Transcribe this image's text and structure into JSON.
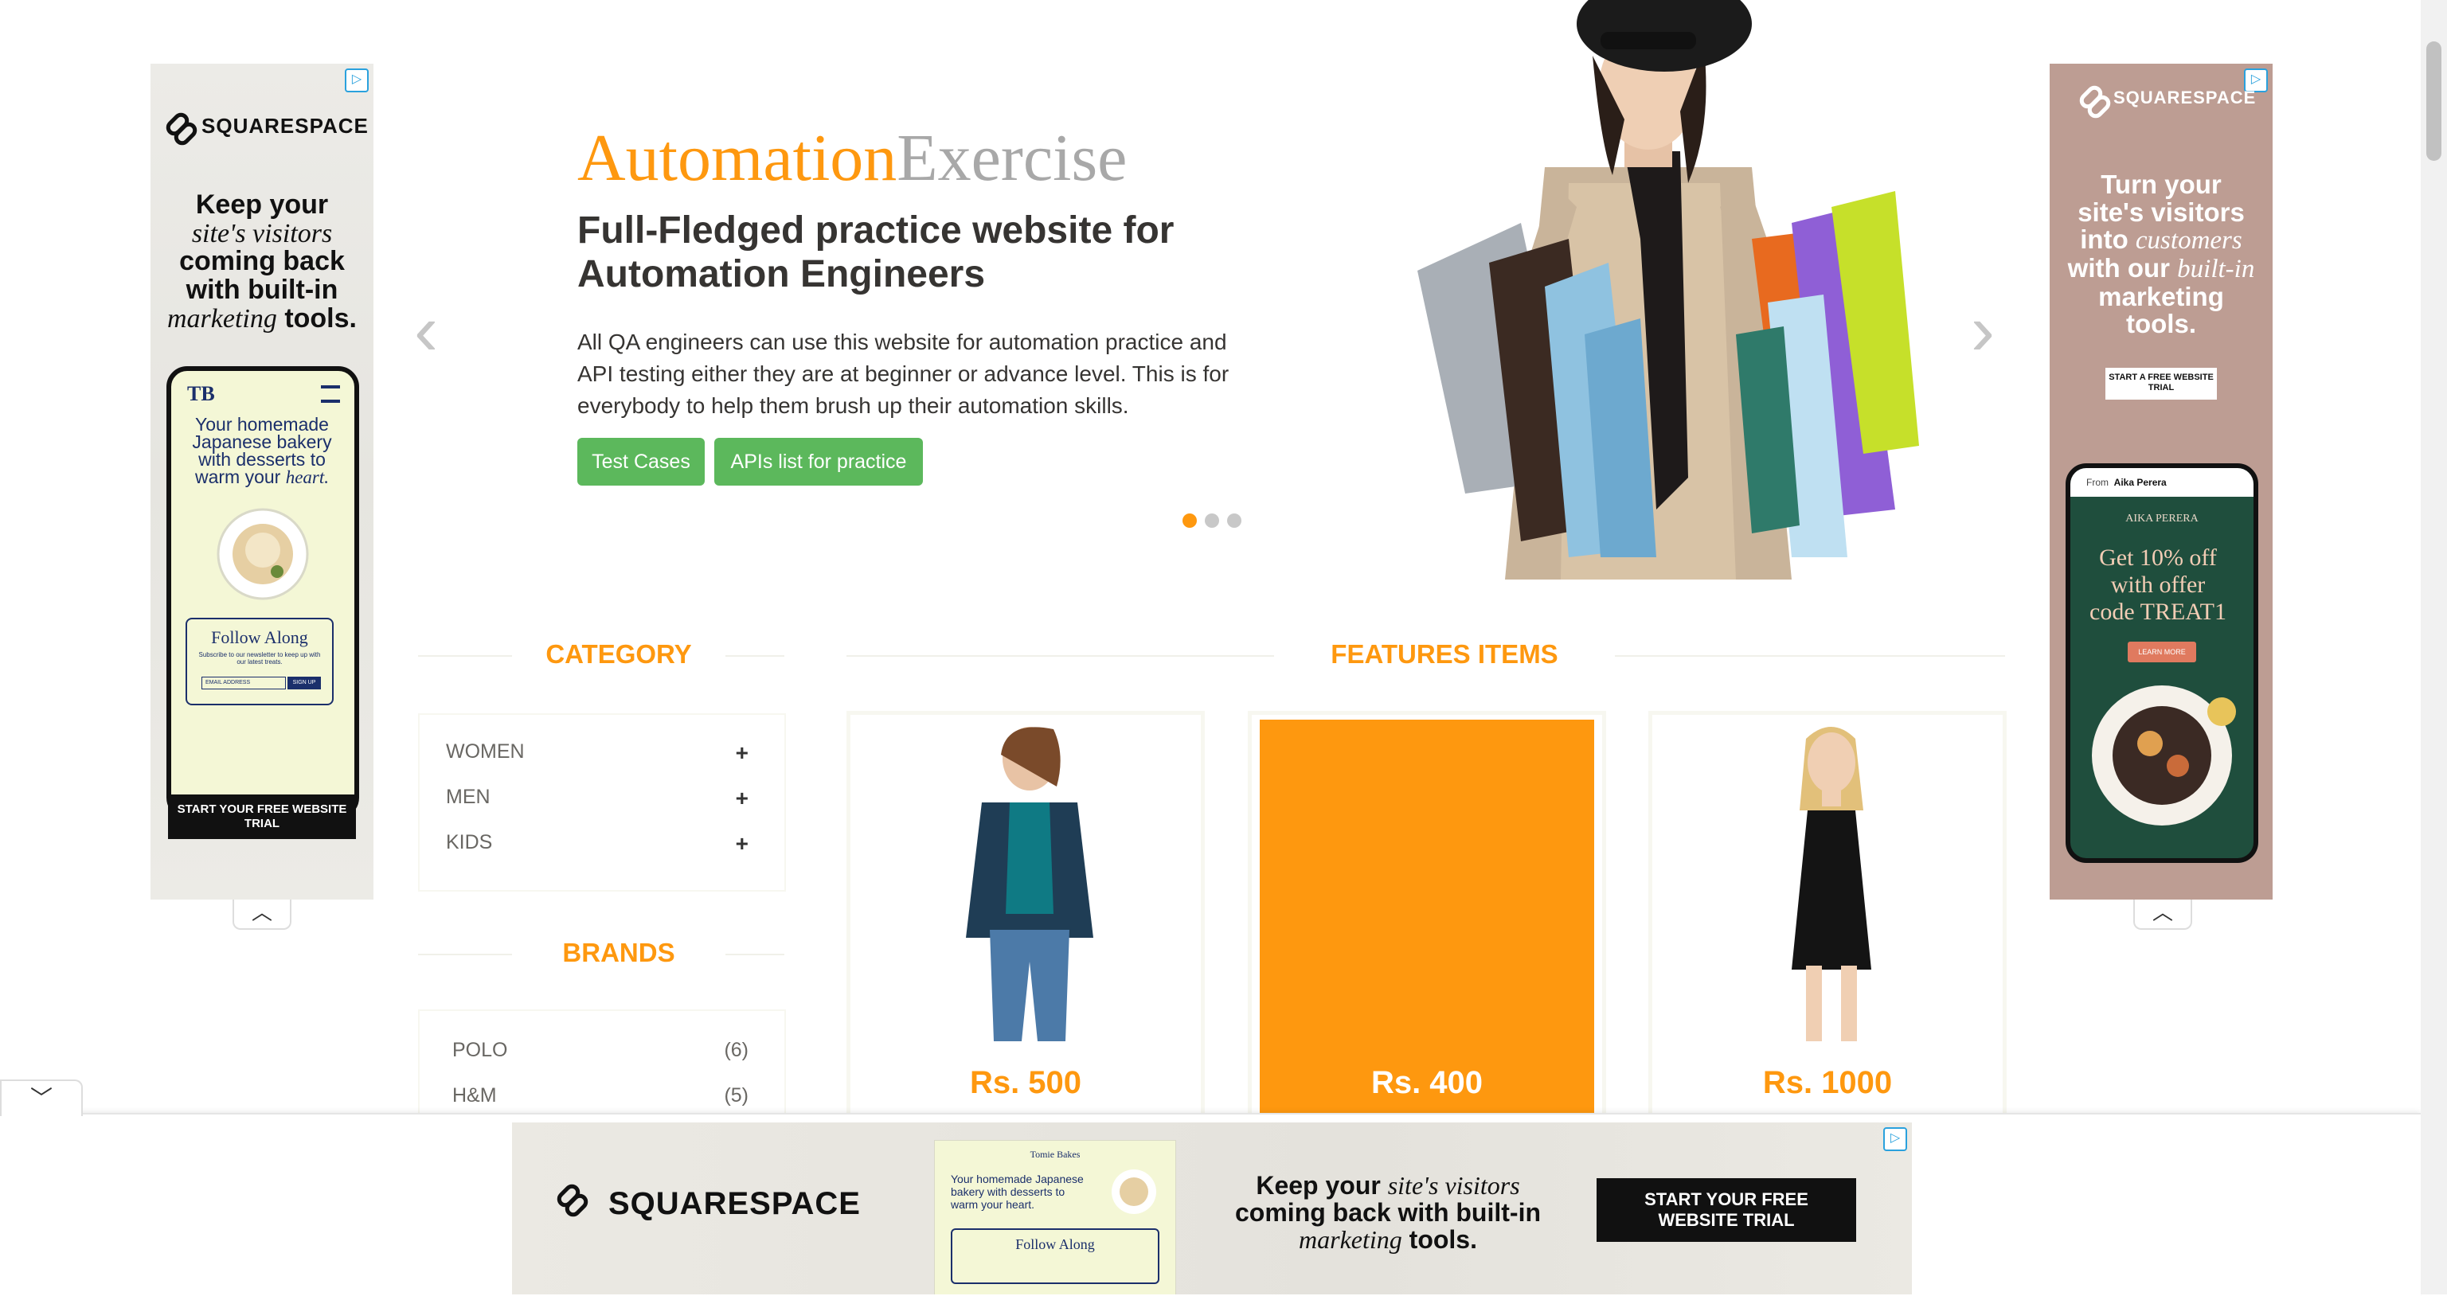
{
  "left_ad": {
    "brand": "SQUARESPACE",
    "headline_plain_1": "Keep your",
    "headline_em": "site's visitors",
    "headline_plain_2": "coming back with built-in",
    "headline_em_2": "marketing",
    "headline_plain_3": "tools.",
    "phone_logo": "TB",
    "phone_text_plain": "Your homemade Japanese bakery with desserts to warm your",
    "phone_text_em": "heart.",
    "follow_title": "Follow Along",
    "follow_note": "Subscribe to our newsletter to keep up with our latest treats.",
    "email_placeholder": "EMAIL ADDRESS",
    "signup": "SIGN UP",
    "cta": "START YOUR FREE WEBSITE TRIAL"
  },
  "right_ad": {
    "brand": "SQUARESPACE",
    "headline_1": "Turn your site's visitors into",
    "headline_em": "customers",
    "headline_2": "with our",
    "headline_em_2": "built-in",
    "headline_3": "marketing tools.",
    "cta": "START A FREE WEBSITE TRIAL",
    "phone_from_label": "From",
    "phone_from_name": "Aika Perera",
    "phone_title": "AIKA PERERA",
    "phone_offer": "Get 10% off with offer code TREAT1",
    "phone_button": "LEARN MORE"
  },
  "slider": {
    "brand_orange": "Automation",
    "brand_grey": "Exercise",
    "heading": "Full-Fledged practice website for Automation Engineers",
    "description": "All QA engineers can use this website for automation practice and API testing either they are at beginner or advance level. This is for everybody to help them brush up their automation skills.",
    "button_test_cases": "Test Cases",
    "button_apis": "APIs list for practice",
    "prev_arrow": "‹",
    "next_arrow": "›",
    "active_slide": 1,
    "slide_count": 3
  },
  "sidebar": {
    "category_title": "CATEGORY",
    "categories": [
      {
        "label": "WOMEN",
        "toggle": "+"
      },
      {
        "label": "MEN",
        "toggle": "+"
      },
      {
        "label": "KIDS",
        "toggle": "+"
      }
    ],
    "brands_title": "BRANDS",
    "brands": [
      {
        "name": "POLO",
        "count": "(6)"
      },
      {
        "name": "H&M",
        "count": "(5)"
      }
    ]
  },
  "features": {
    "title": "FEATURES ITEMS",
    "products": [
      {
        "price": "Rs. 500"
      },
      {
        "price": "Rs. 400"
      },
      {
        "price": "Rs. 1000"
      }
    ]
  },
  "bottom_ad": {
    "brand": "SQUARESPACE",
    "headline_plain_1": "Keep your",
    "headline_em": "site's visitors",
    "headline_plain_2": "coming back with built-in",
    "headline_em_2": "marketing",
    "headline_plain_3": "tools.",
    "cta": "START YOUR FREE WEBSITE TRIAL",
    "phone_title": "Tomie Bakes",
    "phone_text": "Your homemade Japanese bakery with desserts to warm your heart.",
    "follow_title": "Follow Along"
  },
  "colors": {
    "accent_orange": "#FE980F",
    "green_button": "#5CB85C",
    "heading_dark": "#363432"
  }
}
